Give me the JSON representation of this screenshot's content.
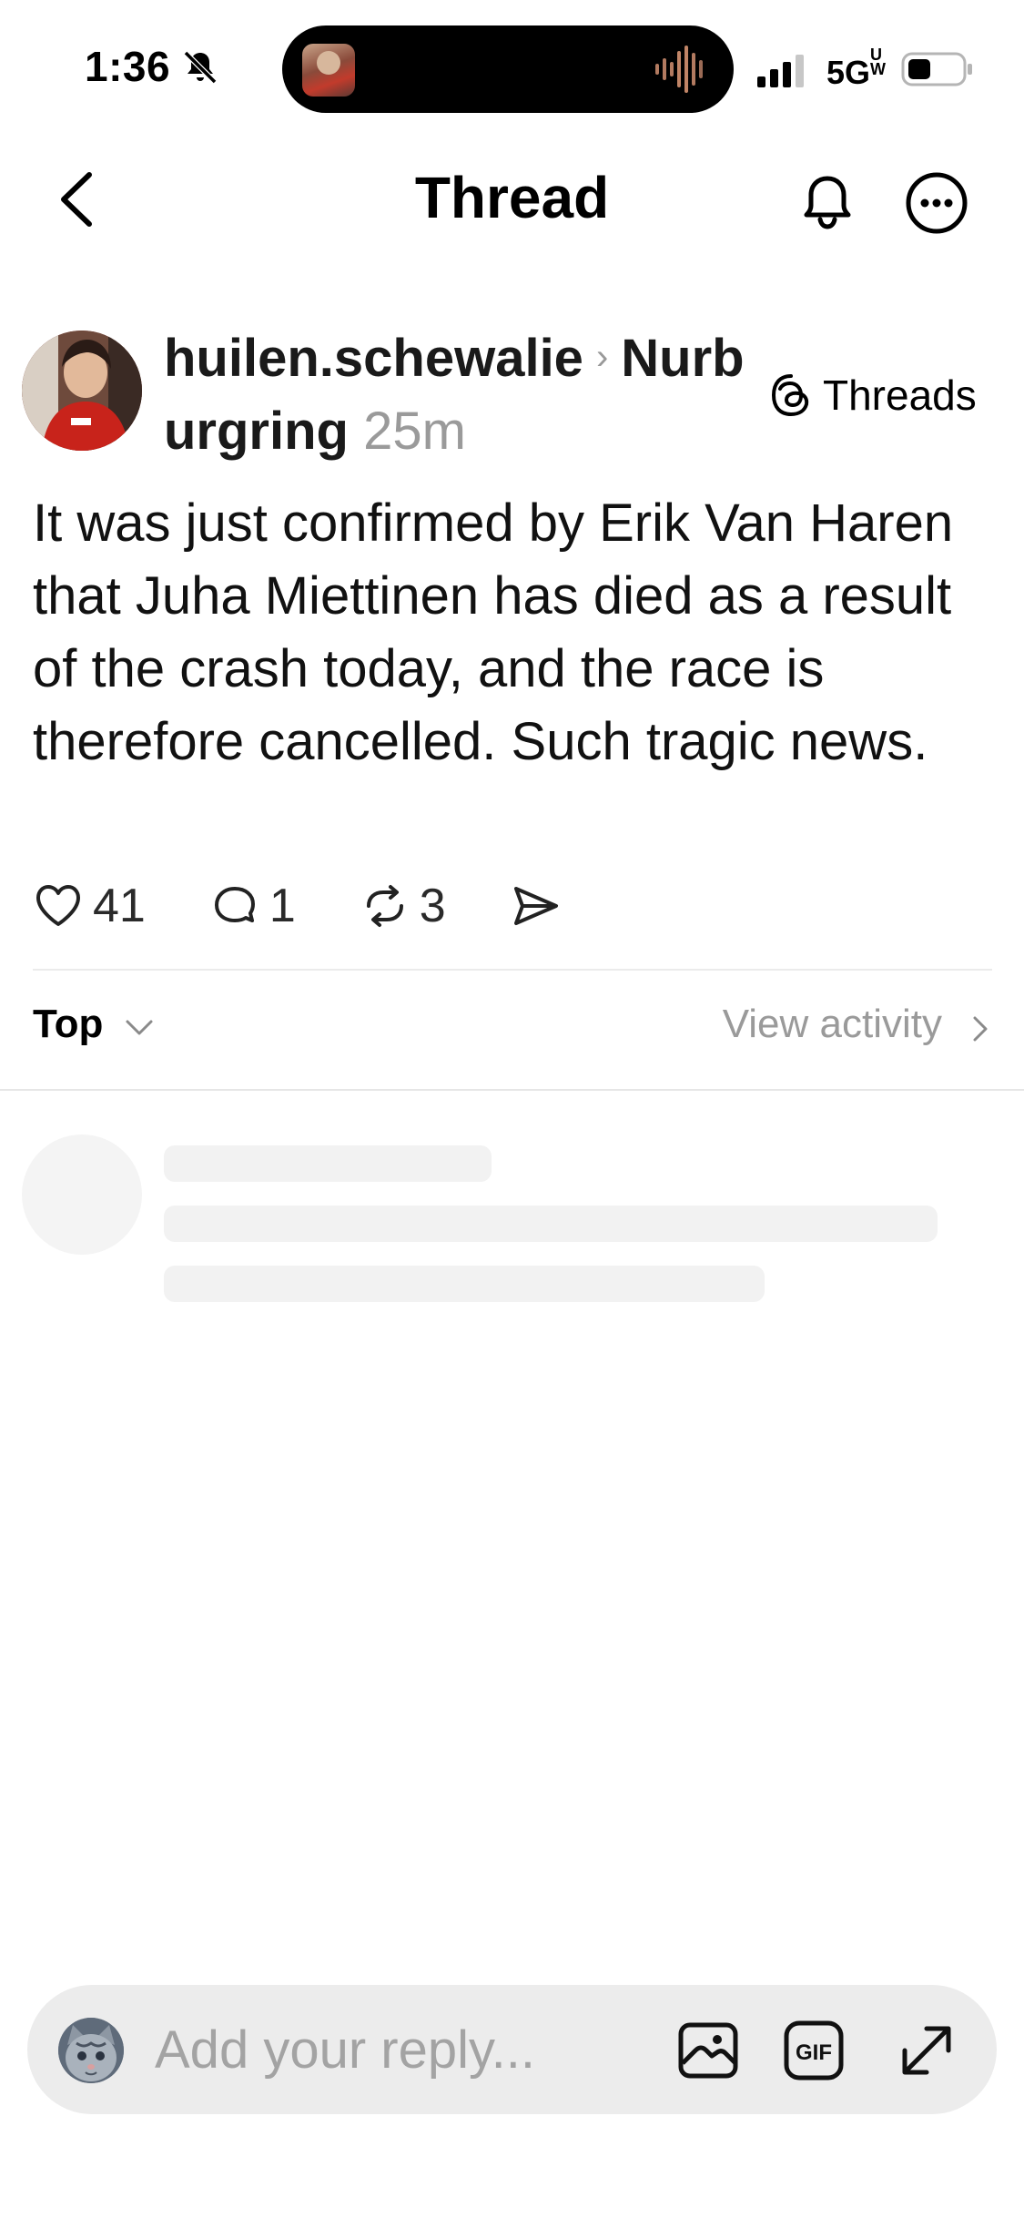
{
  "status_bar": {
    "time": "1:36",
    "network": "5G",
    "network_suffix": "UW"
  },
  "header": {
    "title": "Thread"
  },
  "post": {
    "username": "huilen.schewalie",
    "topic": "Nurburgring",
    "time_ago": "25m",
    "source_label": "Threads",
    "body": "It was just confirmed by Erik Van Haren that Juha Miettinen has died as a result of the crash today, and the race is therefore cancelled. Such tragic news.",
    "likes": "41",
    "replies": "1",
    "reposts": "3"
  },
  "sort": {
    "label": "Top",
    "view_activity": "View activity"
  },
  "composer": {
    "placeholder": "Add your reply...",
    "gif_label": "GIF"
  },
  "colors": {
    "accent_avatar": "#b3231c",
    "muted_text": "#9a9a9a",
    "composer_bg": "#ececec"
  }
}
